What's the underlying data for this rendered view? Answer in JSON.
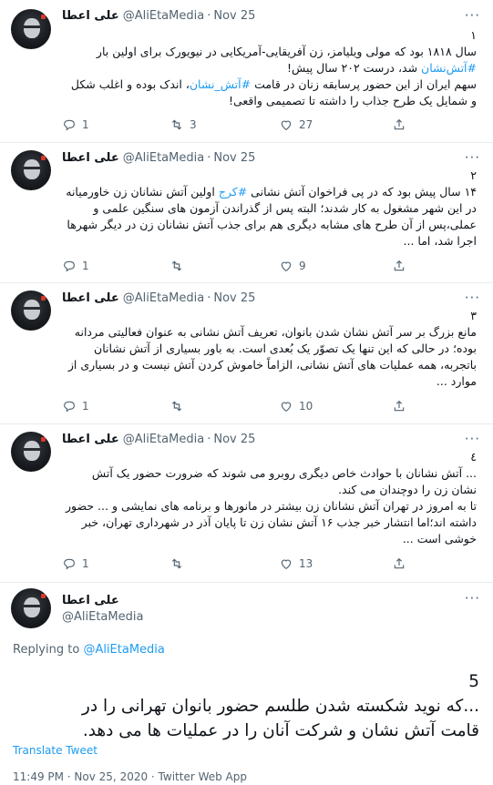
{
  "author": {
    "name": "علی اعطا",
    "handle": "@AliEtaMedia",
    "date": "Nov 25"
  },
  "more_glyph": "···",
  "tweets": [
    {
      "num": "۱",
      "lines": [
        "سال ۱۸۱۸ بود که مولی ویلیامز، زن آفریقایی-آمریکایی در نیویورک برای اولین بار",
        [
          "#آتش‌نشان",
          " شد، درست ۲۰۲ سال پیش!"
        ],
        [
          "سهم ایران از این حضور پرسابقه زنان در قامت ",
          "#آتش_نشان",
          "، اندک بوده و اغلب شکل"
        ],
        "و شمایل یک طرح جذاب را داشته تا تصمیمی واقعی!"
      ],
      "replies": "1",
      "retweets": "3",
      "likes": "27"
    },
    {
      "num": "۲",
      "lines": [
        [
          "۱۴ سال پیش بود که در پی فراخوان آتش نشانی ",
          "#کرج",
          " اولین آتش نشانان زن خاورمیانه"
        ],
        "در این شهر مشغول به کار شدند؛ البته پس از گذراندن آزمون های سنگین علمی و",
        "عملی،پس از آن طرح های مشابه دیگری هم برای جذب آتش نشانان زن در دیگر شهرها",
        "اجرا شد، اما ..."
      ],
      "replies": "1",
      "retweets": "",
      "likes": "9"
    },
    {
      "num": "۳",
      "lines": [
        "مانع بزرگ بر سر آتش نشان شدن بانوان، تعریف آتش نشانی به عنوان فعالیتی مردانه",
        "بوده؛ در حالی که این تنها یک تصوّر یک بُعدی است. به باور بسیاری از آتش نشانان",
        "باتجربه، همه عملیات های آتش نشانی، الزاماً خاموش کردن آتش نیست و در بسیاری از",
        "موارد ..."
      ],
      "replies": "1",
      "retweets": "",
      "likes": "10"
    },
    {
      "num": "٤",
      "lines": [
        "... آتش نشانان با حوادث خاص دیگری روبرو می شوند که ضرورت حضور یک آتش",
        "نشان زن را دوچندان می کند.",
        "تا به امروز در تهران آتش نشانان زن بیشتر در مانورها و برنامه های نمایشی و ... حضور",
        "داشته اند؛اما انتشار خبر جذب ۱۶ آتش نشان زن تا پایان آذر در شهرداری تهران، خبر",
        "خوشی است ..."
      ],
      "replies": "1",
      "retweets": "",
      "likes": "13"
    }
  ],
  "main": {
    "name": "علی اعطا",
    "handle": "@AliEtaMedia",
    "replying_prefix": "Replying to ",
    "replying_handle": "@AliEtaMedia",
    "num": "5",
    "lines": [
      "...که نوید شکسته شدن طلسم حضور بانوان تهرانی را در",
      "قامت آتش نشان و شرکت آنان را در عملیات ها می دهد."
    ],
    "translate": "Translate Tweet",
    "meta": "11:49 PM · Nov 25, 2020 · Twitter Web App"
  }
}
